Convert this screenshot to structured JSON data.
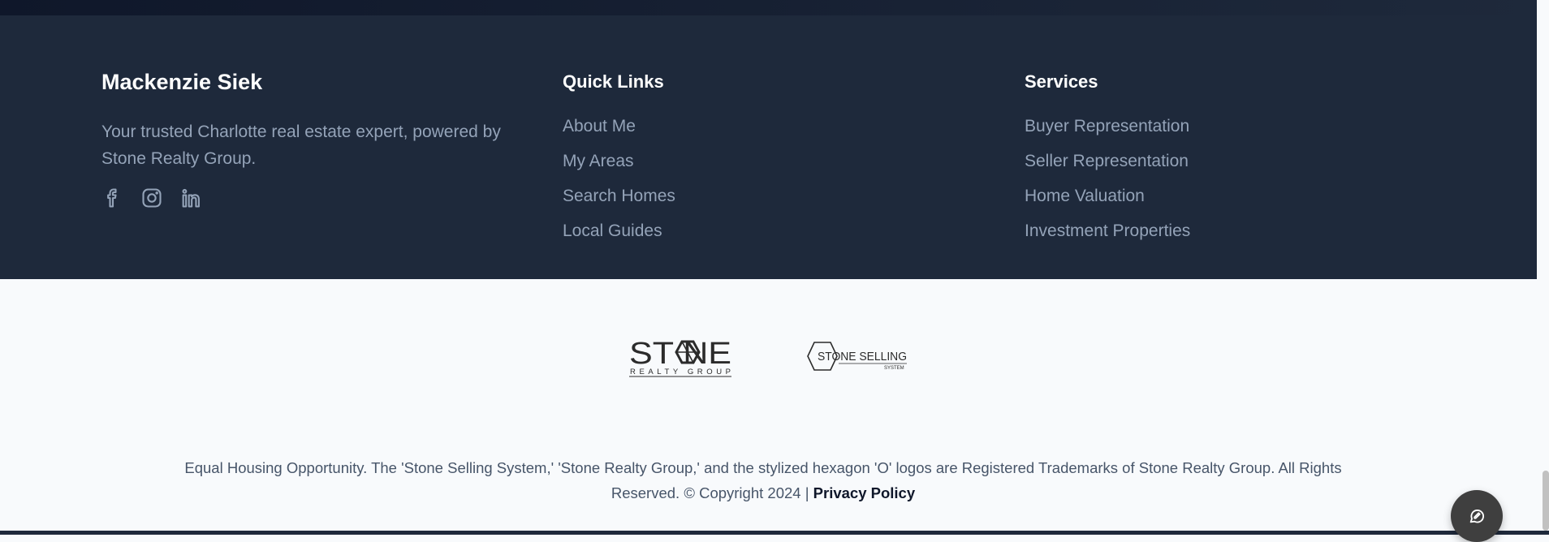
{
  "brand": {
    "name": "Mackenzie Siek",
    "tagline": "Your trusted Charlotte real estate expert, powered by Stone Realty Group.",
    "socials": [
      {
        "name": "facebook",
        "icon": "facebook-icon"
      },
      {
        "name": "instagram",
        "icon": "instagram-icon"
      },
      {
        "name": "linkedin",
        "icon": "linkedin-icon"
      }
    ]
  },
  "quick_links": {
    "title": "Quick Links",
    "items": [
      "About Me",
      "My Areas",
      "Search Homes",
      "Local Guides"
    ]
  },
  "services": {
    "title": "Services",
    "items": [
      "Buyer Representation",
      "Seller Representation",
      "Home Valuation",
      "Investment Properties"
    ]
  },
  "logos": {
    "stone_realty": {
      "word": "STONE",
      "sub": "REALTY GROUP"
    },
    "stone_selling": {
      "word": "STONE SELLING",
      "sub": "SYSTEM"
    }
  },
  "legal": {
    "text": "Equal Housing Opportunity. The 'Stone Selling System,' 'Stone Realty Group,' and the stylized hexagon 'O' logos are Registered Trademarks of Stone Realty Group. All Rights Reserved. © Copyright 2024 | ",
    "privacy_label": "Privacy Policy"
  },
  "chat": {
    "icon": "chat-icon"
  },
  "colors": {
    "footer_bg": "#1e293b",
    "heading": "#ffffff",
    "link": "#94a3b8",
    "page_bg": "#f8fafc",
    "legal_text": "#475569",
    "chat_button": "#3f3f3f"
  }
}
